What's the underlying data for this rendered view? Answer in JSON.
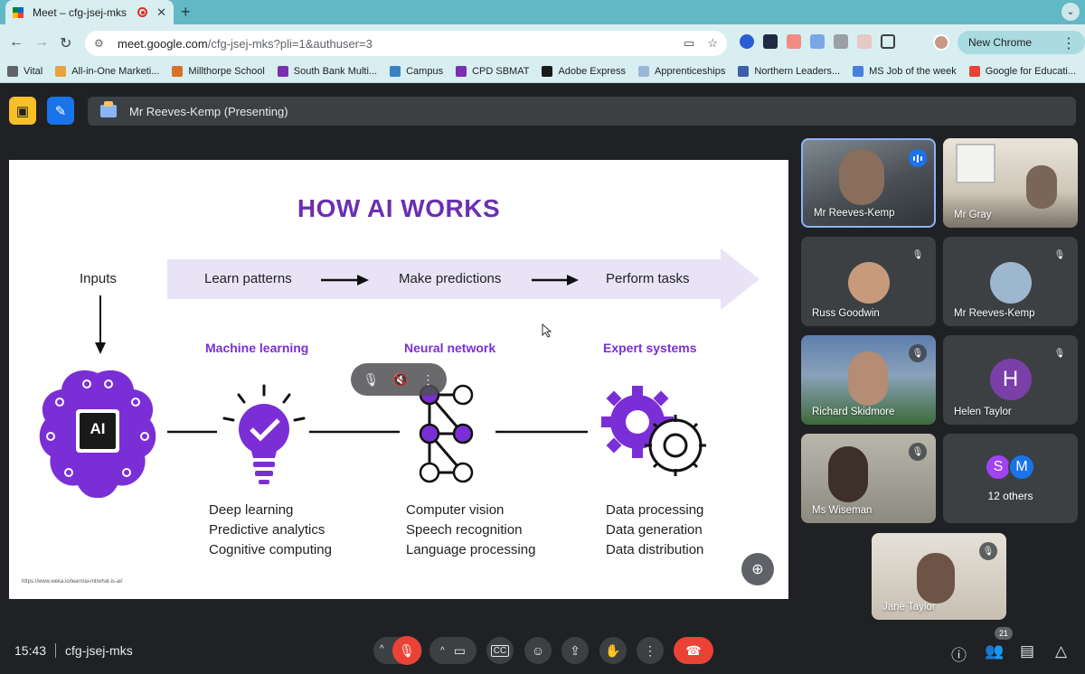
{
  "browser": {
    "tab_title": "Meet – cfg-jsej-mks",
    "url_host": "meet.google.com",
    "url_path": "/cfg-jsej-mks?pli=1&authuser=3",
    "new_chrome_label": "New Chrome available",
    "bookmarks": [
      {
        "label": "Vital",
        "color": "#5f6368"
      },
      {
        "label": "All-in-One Marketi...",
        "color": "#e8a33b"
      },
      {
        "label": "Millthorpe School",
        "color": "#d9702b"
      },
      {
        "label": "South Bank Multi...",
        "color": "#7b2fb0"
      },
      {
        "label": "Campus",
        "color": "#3b82c4"
      },
      {
        "label": "CPD SBMAT",
        "color": "#7b2fb0"
      },
      {
        "label": "Adobe Express",
        "color": "#1a1a1a"
      },
      {
        "label": "Apprenticeships",
        "color": "#9ab8d6"
      },
      {
        "label": "Northern Leaders...",
        "color": "#3c5fa8"
      },
      {
        "label": "MS Job of the week",
        "color": "#4a7ee0"
      },
      {
        "label": "Google for Educati...",
        "color": "#ea4335"
      }
    ]
  },
  "meet": {
    "presenting_label": "Mr Reeves-Kemp (Presenting)",
    "meeting_time": "15:43",
    "meeting_code": "cfg-jsej-mks",
    "people_count": "21",
    "accent": "#8ab4f8",
    "end_call_color": "#ea4335"
  },
  "slide": {
    "title": "HOW AI WORKS",
    "inputs_label": "Inputs",
    "flow": [
      "Learn patterns",
      "Make predictions",
      "Perform tasks"
    ],
    "brain_label": "AI",
    "categories": [
      {
        "title": "Machine learning",
        "items": [
          "Deep learning",
          "Predictive analytics",
          "Cognitive computing"
        ]
      },
      {
        "title": "Neural network",
        "items": [
          "Computer vision",
          "Speech recognition",
          "Language processing"
        ]
      },
      {
        "title": "Expert systems",
        "items": [
          "Data processing",
          "Data generation",
          "Data distribution"
        ]
      }
    ],
    "source": "https://www.weka.io/learn/ai-ml/what-is-ai/",
    "purple": "#7a2fd6"
  },
  "participants": [
    {
      "name": "Mr Reeves-Kemp",
      "state": "speaking"
    },
    {
      "name": "Mr Gray",
      "state": "video"
    },
    {
      "name": "Russ Goodwin",
      "state": "muted"
    },
    {
      "name": "Mr Reeves-Kemp",
      "state": "muted"
    },
    {
      "name": "Richard Skidmore",
      "state": "muted"
    },
    {
      "name": "Helen Taylor",
      "state": "muted",
      "initial": "H"
    },
    {
      "name": "Ms Wiseman",
      "state": "muted"
    },
    {
      "name": "12 others",
      "initials": [
        "S",
        "M"
      ]
    },
    {
      "name": "Jane Taylor",
      "state": "muted"
    }
  ]
}
